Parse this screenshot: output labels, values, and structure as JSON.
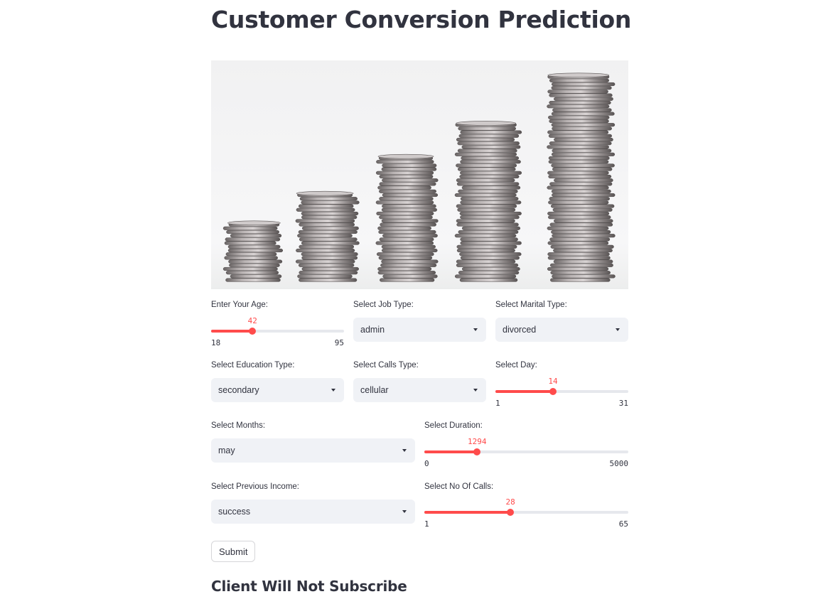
{
  "page": {
    "title": "Customer Conversion Prediction"
  },
  "image": {
    "alt": "coin-stacks"
  },
  "colors": {
    "accent": "#ff4b4b",
    "input_bg": "#f0f2f6",
    "text": "#31333f"
  },
  "form": {
    "age": {
      "label": "Enter Your Age:",
      "value": "42",
      "min": "18",
      "max": "95"
    },
    "job": {
      "label": "Select Job Type:",
      "value": "admin"
    },
    "marital": {
      "label": "Select Marital Type:",
      "value": "divorced"
    },
    "education": {
      "label": "Select Education Type:",
      "value": "secondary"
    },
    "calls_type": {
      "label": "Select Calls Type:",
      "value": "cellular"
    },
    "day": {
      "label": "Select Day:",
      "value": "14",
      "min": "1",
      "max": "31"
    },
    "months": {
      "label": "Select Months:",
      "value": "may"
    },
    "duration": {
      "label": "Select Duration:",
      "value": "1294",
      "min": "0",
      "max": "5000"
    },
    "previous_income": {
      "label": "Select Previous Income:",
      "value": "success"
    },
    "no_of_calls": {
      "label": "Select No Of Calls:",
      "value": "28",
      "min": "1",
      "max": "65"
    },
    "submit_label": "Submit"
  },
  "result": {
    "text": "Client Will Not Subscribe"
  }
}
